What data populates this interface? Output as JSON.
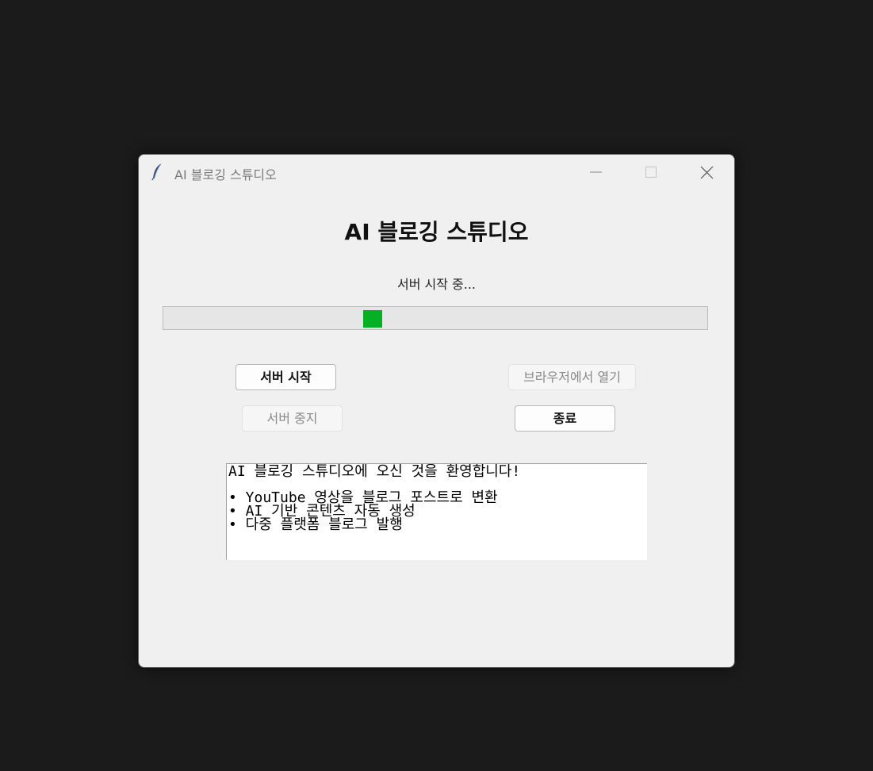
{
  "window": {
    "title": "AI 블로깅 스튜디오",
    "app_icon": "feather-icon",
    "controls": [
      "minimize-icon",
      "maximize-icon",
      "close-icon"
    ]
  },
  "main": {
    "heading": "AI 블로깅 스튜디오",
    "status": "서버 시작 중...",
    "progress": {
      "mode": "indeterminate",
      "color": "#06b025"
    },
    "buttons": {
      "start_server": "서버 시작",
      "open_browser": "브라우저에서 열기",
      "stop_server": "서버 중지",
      "exit": "종료"
    },
    "log": {
      "welcome": "AI 블로깅 스튜디오에 오신 것을 환영합니다!",
      "features": [
        "• YouTube 영상을 블로그 포스트로 변환",
        "• AI 기반 콘텐츠 자동 생성",
        "• 다중 플랫폼 블로그 발행"
      ]
    }
  }
}
